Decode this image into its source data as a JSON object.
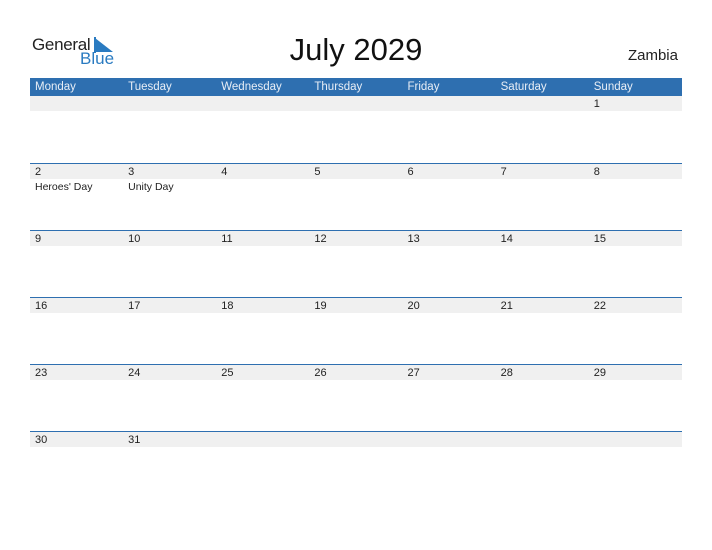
{
  "logo": {
    "general": "General",
    "blue": "Blue"
  },
  "title": "July 2029",
  "country": "Zambia",
  "colors": {
    "accent": "#2e6fb0",
    "band": "#f0f0f0"
  },
  "weekdays": [
    "Monday",
    "Tuesday",
    "Wednesday",
    "Thursday",
    "Friday",
    "Saturday",
    "Sunday"
  ],
  "weeks": [
    [
      {
        "d": ""
      },
      {
        "d": ""
      },
      {
        "d": ""
      },
      {
        "d": ""
      },
      {
        "d": ""
      },
      {
        "d": ""
      },
      {
        "d": "1"
      }
    ],
    [
      {
        "d": "2",
        "h": "Heroes' Day"
      },
      {
        "d": "3",
        "h": "Unity Day"
      },
      {
        "d": "4"
      },
      {
        "d": "5"
      },
      {
        "d": "6"
      },
      {
        "d": "7"
      },
      {
        "d": "8"
      }
    ],
    [
      {
        "d": "9"
      },
      {
        "d": "10"
      },
      {
        "d": "11"
      },
      {
        "d": "12"
      },
      {
        "d": "13"
      },
      {
        "d": "14"
      },
      {
        "d": "15"
      }
    ],
    [
      {
        "d": "16"
      },
      {
        "d": "17"
      },
      {
        "d": "18"
      },
      {
        "d": "19"
      },
      {
        "d": "20"
      },
      {
        "d": "21"
      },
      {
        "d": "22"
      }
    ],
    [
      {
        "d": "23"
      },
      {
        "d": "24"
      },
      {
        "d": "25"
      },
      {
        "d": "26"
      },
      {
        "d": "27"
      },
      {
        "d": "28"
      },
      {
        "d": "29"
      }
    ],
    [
      {
        "d": "30"
      },
      {
        "d": "31"
      },
      {
        "d": ""
      },
      {
        "d": ""
      },
      {
        "d": ""
      },
      {
        "d": ""
      },
      {
        "d": ""
      }
    ]
  ]
}
